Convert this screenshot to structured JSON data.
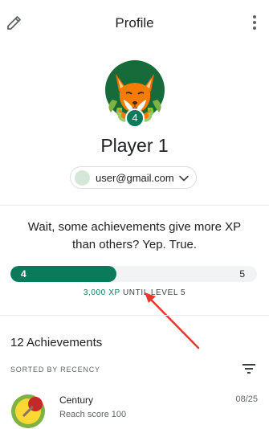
{
  "header": {
    "title": "Profile",
    "edit_icon": "pencil-icon",
    "menu_icon": "more-vert-icon"
  },
  "profile": {
    "level_badge": "4",
    "player_name": "Player 1",
    "account_email": "user@gmail.com",
    "dropdown_icon": "chevron-down-icon"
  },
  "progress": {
    "tip_line1": "Wait, some achievements give more XP",
    "tip_line2": "than others? Yep. True.",
    "current_level": "4",
    "next_level": "5",
    "fill_fraction": 0.43,
    "xp_text": "3,000 XP",
    "until_text": "UNTIL LEVEL 5"
  },
  "achievements": {
    "title": "12 Achievements",
    "sort_label": "SORTED BY RECENCY",
    "sort_icon": "sort-icon",
    "items": [
      {
        "name": "Century",
        "description": "Reach score 100",
        "date": "08/25"
      }
    ]
  },
  "colors": {
    "accent": "#0b7a5a",
    "annotation_arrow": "#e8372d"
  }
}
